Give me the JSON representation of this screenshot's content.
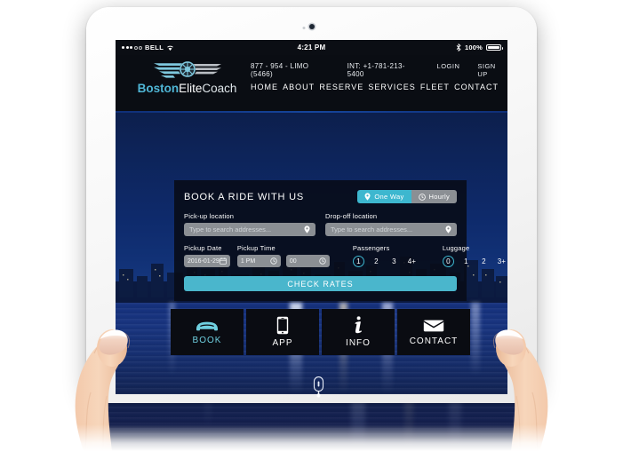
{
  "device": {
    "type": "tablet",
    "status_bar": {
      "carrier": "BELL",
      "signal_filled": 3,
      "signal_empty": 2,
      "wifi_icon": "wifi-icon",
      "time": "4:21 PM",
      "bluetooth_icon": "bluetooth-icon",
      "battery_percent": "100%"
    }
  },
  "site": {
    "logo": {
      "mark": "winged-wheel-icon",
      "word_1": "Boston",
      "word_2": "Elite",
      "word_3": "Coach"
    },
    "topbar": {
      "phone_domestic": "877 - 954 - LIMO (5466)",
      "phone_international": "INT: +1-781-213-5400",
      "login": "LOGIN",
      "signup": "SIGN UP"
    },
    "nav": [
      {
        "label": "HOME"
      },
      {
        "label": "ABOUT"
      },
      {
        "label": "RESERVE"
      },
      {
        "label": "SERVICES"
      },
      {
        "label": "FLEET"
      },
      {
        "label": "CONTACT"
      }
    ]
  },
  "booking": {
    "title": "BOOK A RIDE WITH US",
    "trip_type": {
      "one_way": {
        "label": "One Way",
        "icon": "map-pin-icon",
        "active": true
      },
      "hourly": {
        "label": "Hourly",
        "icon": "clock-icon",
        "active": false
      }
    },
    "pickup_location": {
      "label": "Pick-up location",
      "placeholder": "Type to search addresses...",
      "value": "",
      "icon": "map-pin-icon"
    },
    "dropoff_location": {
      "label": "Drop-off location",
      "placeholder": "Type to search addresses...",
      "value": "",
      "icon": "map-pin-icon"
    },
    "pickup_date": {
      "label": "Pickup Date",
      "value": "2016-01-29",
      "icon": "calendar-icon"
    },
    "pickup_time": {
      "label": "Pickup Time",
      "hour_value": "1 PM",
      "minute_value": "00",
      "icon": "clock-icon"
    },
    "passengers": {
      "label": "Passengers",
      "options": [
        "1",
        "2",
        "3",
        "4+"
      ],
      "selected": "1"
    },
    "luggage": {
      "label": "Luggage",
      "options": [
        "0",
        "1",
        "2",
        "3+"
      ],
      "selected": "0"
    },
    "submit_label": "CHECK RATES"
  },
  "tiles": [
    {
      "label": "BOOK",
      "icon": "car-icon",
      "active": true
    },
    {
      "label": "APP",
      "icon": "phone-icon",
      "active": false
    },
    {
      "label": "INFO",
      "icon": "info-icon",
      "active": false
    },
    {
      "label": "CONTACT",
      "icon": "envelope-icon",
      "active": false
    }
  ],
  "colors": {
    "accent_teal": "#3db7cf",
    "button_teal": "#4ab6cc",
    "panel_dark": "#080c18",
    "header_dark": "#0a0d13",
    "water_blue": "#16317c",
    "inactive_gray": "#8b8f94"
  }
}
